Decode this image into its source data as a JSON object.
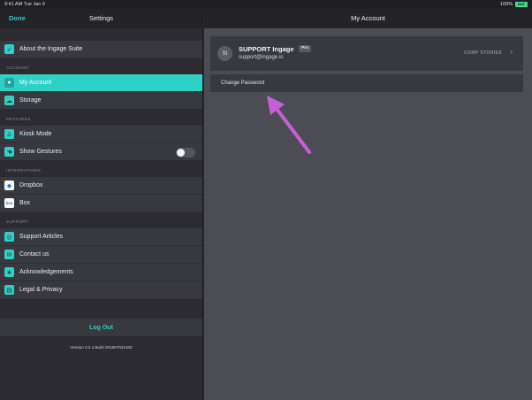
{
  "status_bar": {
    "time": "9:41 AM   Tue Jan 9",
    "battery_pct": "100%",
    "battery_label": "BAT"
  },
  "left": {
    "done_label": "Done",
    "title": "Settings",
    "top_item": "About the Ingage Suite",
    "sections": {
      "account": "ACCOUNT",
      "features": "FEATURES",
      "integrations": "INTEGRATIONS",
      "support": "SUPPORT"
    },
    "account_items": [
      "My Account",
      "Storage"
    ],
    "feature_items": [
      "Kiosk Mode",
      "Show Gestures"
    ],
    "integration_items": [
      "Dropbox",
      "Box"
    ],
    "support_items": [
      "Support Articles",
      "Contact us",
      "Acknowledgements",
      "Legal & Privacy"
    ],
    "logout_label": "Log Out",
    "version": "Version 3.2.4 Build 201907021400",
    "box_icon_text": "box"
  },
  "right": {
    "title": "My Account",
    "avatar_initials": "SI",
    "account_name": "SUPPORT Ingage",
    "badge": "Pro",
    "email": "support@ingage.io",
    "comp_stories": "COMP STORIES",
    "change_password": "Change Password"
  },
  "colors": {
    "accent": "#2ed1c7",
    "panel": "#38383f",
    "background_right": "#4c4c55",
    "annotation_arrow": "#c95ed6"
  },
  "icons": {
    "about": "rocket-icon",
    "my_account": "person-icon",
    "storage": "cloud-icon",
    "kiosk": "kiosk-icon",
    "gestures": "hand-icon",
    "dropbox": "dropbox-icon",
    "box": "box-icon",
    "support": "lifebuoy-icon",
    "contact": "mail-icon",
    "acknowledgements": "star-icon",
    "legal": "document-icon"
  }
}
